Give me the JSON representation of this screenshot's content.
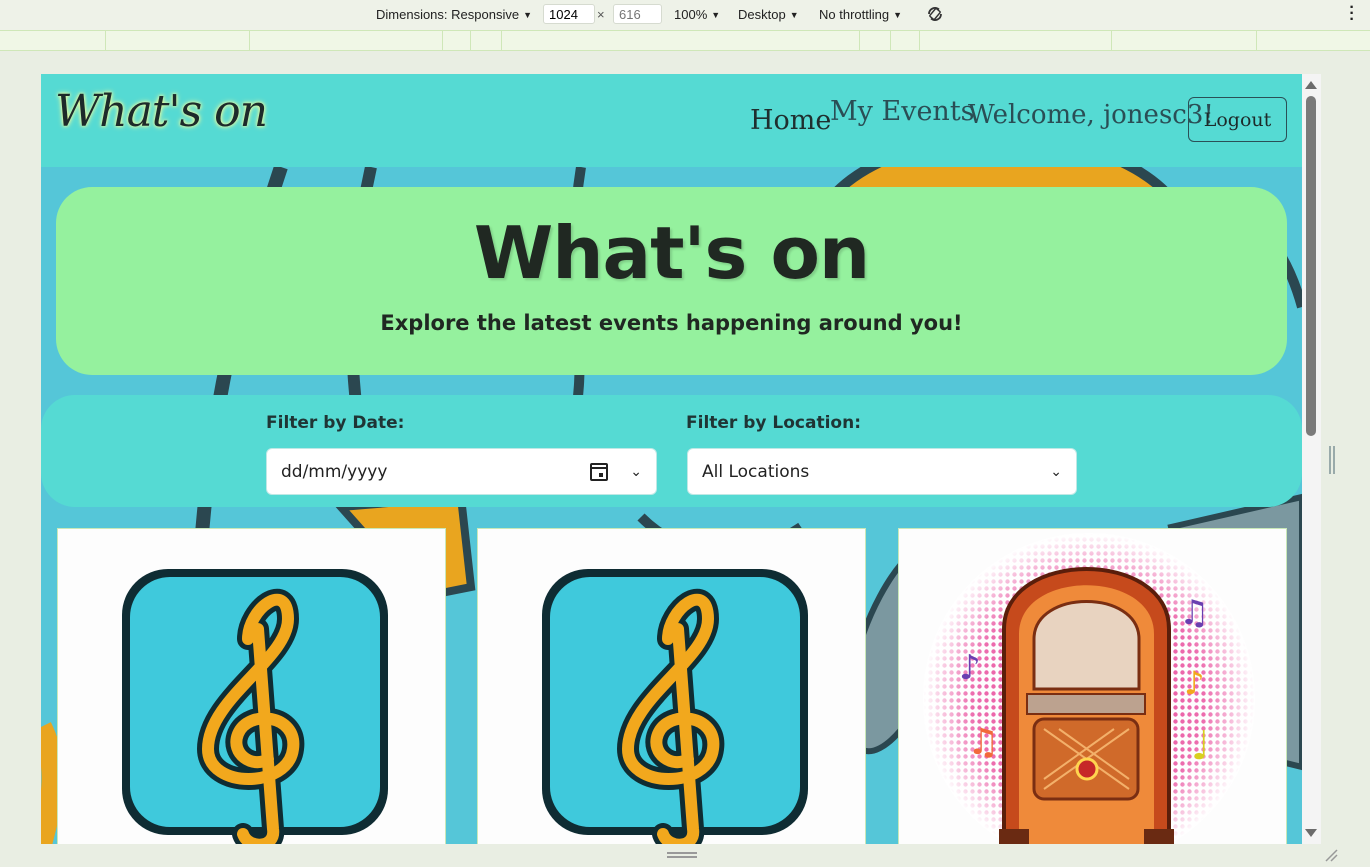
{
  "devtools": {
    "dimensions_label": "Dimensions: Responsive",
    "width": "1024",
    "height_placeholder": "616",
    "times": "×",
    "zoom": "100%",
    "device": "Desktop",
    "throttling": "No throttling",
    "rotate_icon": "rotate-icon",
    "menu_icon": "kebab-menu-icon"
  },
  "nav": {
    "brand": "What's on",
    "home": "Home",
    "my_events": "My Events",
    "welcome": "Welcome, jonesc3!",
    "logout": "Logout"
  },
  "hero": {
    "title": "What's on",
    "subtitle": "Explore the latest events happening around you!"
  },
  "filters": {
    "date_label": "Filter by Date:",
    "date_placeholder": "dd/mm/yyyy",
    "location_label": "Filter by Location:",
    "location_value": "All Locations"
  },
  "cards": [
    {
      "image": "treble-clef-icon"
    },
    {
      "image": "treble-clef-icon"
    },
    {
      "image": "jukebox-illustration"
    }
  ],
  "colors": {
    "navbar": "#55dad3",
    "hero": "#95f19e",
    "background": "#55c6d8",
    "clef_tile": "#3fc9dc",
    "clef": "#f2a81d"
  }
}
